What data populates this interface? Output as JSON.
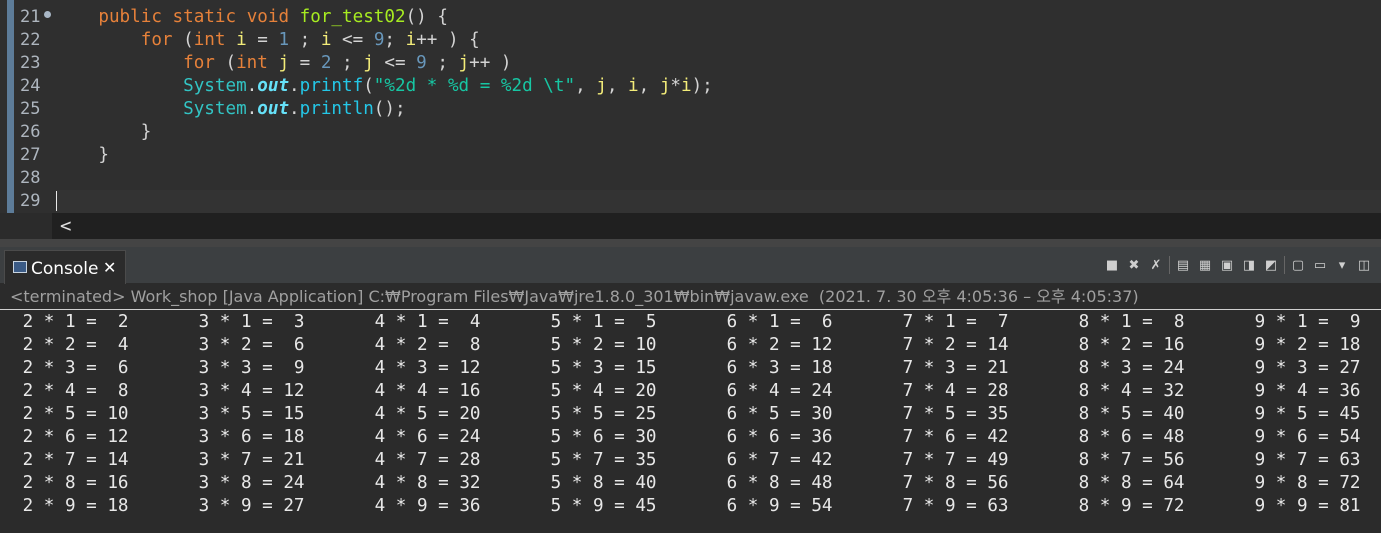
{
  "editor": {
    "line_numbers": [
      "21",
      "22",
      "23",
      "24",
      "25",
      "26",
      "27",
      "28",
      "29"
    ],
    "lines": [
      [
        {
          "t": "    "
        },
        {
          "t": "public",
          "c": "kw"
        },
        {
          "t": " "
        },
        {
          "t": "static",
          "c": "kw"
        },
        {
          "t": " "
        },
        {
          "t": "void",
          "c": "kw"
        },
        {
          "t": " "
        },
        {
          "t": "for_test02",
          "c": "fn"
        },
        {
          "t": "() {"
        }
      ],
      [
        {
          "t": "        "
        },
        {
          "t": "for",
          "c": "kw"
        },
        {
          "t": " ("
        },
        {
          "t": "int",
          "c": "kw"
        },
        {
          "t": " "
        },
        {
          "t": "i",
          "c": "var"
        },
        {
          "t": " = "
        },
        {
          "t": "1",
          "c": "num"
        },
        {
          "t": " ; "
        },
        {
          "t": "i",
          "c": "var"
        },
        {
          "t": " <= "
        },
        {
          "t": "9",
          "c": "num"
        },
        {
          "t": "; "
        },
        {
          "t": "i",
          "c": "var"
        },
        {
          "t": "++ ) {"
        }
      ],
      [
        {
          "t": "            "
        },
        {
          "t": "for",
          "c": "kw"
        },
        {
          "t": " ("
        },
        {
          "t": "int",
          "c": "kw"
        },
        {
          "t": " "
        },
        {
          "t": "j",
          "c": "var"
        },
        {
          "t": " = "
        },
        {
          "t": "2",
          "c": "num"
        },
        {
          "t": " ; "
        },
        {
          "t": "j",
          "c": "var"
        },
        {
          "t": " <= "
        },
        {
          "t": "9",
          "c": "num"
        },
        {
          "t": " ; "
        },
        {
          "t": "j",
          "c": "var"
        },
        {
          "t": "++ )"
        }
      ],
      [
        {
          "t": "            "
        },
        {
          "t": "System",
          "c": "cls"
        },
        {
          "t": "."
        },
        {
          "t": "out",
          "c": "fld"
        },
        {
          "t": "."
        },
        {
          "t": "printf",
          "c": "mth"
        },
        {
          "t": "("
        },
        {
          "t": "\"%2d * %d = %2d \\t\"",
          "c": "str"
        },
        {
          "t": ", "
        },
        {
          "t": "j",
          "c": "var"
        },
        {
          "t": ", "
        },
        {
          "t": "i",
          "c": "var"
        },
        {
          "t": ", "
        },
        {
          "t": "j",
          "c": "var"
        },
        {
          "t": "*"
        },
        {
          "t": "i",
          "c": "var"
        },
        {
          "t": ");"
        }
      ],
      [
        {
          "t": "            "
        },
        {
          "t": "System",
          "c": "cls"
        },
        {
          "t": "."
        },
        {
          "t": "out",
          "c": "fld"
        },
        {
          "t": "."
        },
        {
          "t": "println",
          "c": "mth"
        },
        {
          "t": "();"
        }
      ],
      [
        {
          "t": "        }"
        }
      ],
      [
        {
          "t": "    }"
        }
      ],
      [
        {
          "t": ""
        }
      ],
      [
        {
          "t": ""
        }
      ]
    ],
    "hscroll_left_icon": "chevron-left-icon"
  },
  "console": {
    "tab_label": "Console",
    "close_glyph": "✕",
    "status": "<terminated> Work_shop [Java Application] C:₩Program Files₩Java₩jre1.8.0_301₩bin₩javaw.exe  (2021. 7. 30 오후 4:05:36 – 오후 4:05:37)",
    "toolbar_icons": [
      "terminate-icon",
      "remove-launch-icon",
      "remove-all-terminated-icon",
      "scroll-lock-icon",
      "word-wrap-icon",
      "show-console-on-output-icon",
      "show-console-on-error-icon",
      "pin-console-icon",
      "display-selected-console-icon",
      "open-console-icon",
      "new-console-icon"
    ],
    "output_rows": [
      [
        " 2 * 1 =  2",
        " 3 * 1 =  3",
        " 4 * 1 =  4",
        " 5 * 1 =  5",
        " 6 * 1 =  6",
        " 7 * 1 =  7",
        " 8 * 1 =  8",
        " 9 * 1 =  9"
      ],
      [
        " 2 * 2 =  4",
        " 3 * 2 =  6",
        " 4 * 2 =  8",
        " 5 * 2 = 10",
        " 6 * 2 = 12",
        " 7 * 2 = 14",
        " 8 * 2 = 16",
        " 9 * 2 = 18"
      ],
      [
        " 2 * 3 =  6",
        " 3 * 3 =  9",
        " 4 * 3 = 12",
        " 5 * 3 = 15",
        " 6 * 3 = 18",
        " 7 * 3 = 21",
        " 8 * 3 = 24",
        " 9 * 3 = 27"
      ],
      [
        " 2 * 4 =  8",
        " 3 * 4 = 12",
        " 4 * 4 = 16",
        " 5 * 4 = 20",
        " 6 * 4 = 24",
        " 7 * 4 = 28",
        " 8 * 4 = 32",
        " 9 * 4 = 36"
      ],
      [
        " 2 * 5 = 10",
        " 3 * 5 = 15",
        " 4 * 5 = 20",
        " 5 * 5 = 25",
        " 6 * 5 = 30",
        " 7 * 5 = 35",
        " 8 * 5 = 40",
        " 9 * 5 = 45"
      ],
      [
        " 2 * 6 = 12",
        " 3 * 6 = 18",
        " 4 * 6 = 24",
        " 5 * 6 = 30",
        " 6 * 6 = 36",
        " 7 * 6 = 42",
        " 8 * 6 = 48",
        " 9 * 6 = 54"
      ],
      [
        " 2 * 7 = 14",
        " 3 * 7 = 21",
        " 4 * 7 = 28",
        " 5 * 7 = 35",
        " 6 * 7 = 42",
        " 7 * 7 = 49",
        " 8 * 7 = 56",
        " 9 * 7 = 63"
      ],
      [
        " 2 * 8 = 16",
        " 3 * 8 = 24",
        " 4 * 8 = 32",
        " 5 * 8 = 40",
        " 6 * 8 = 48",
        " 7 * 8 = 56",
        " 8 * 8 = 64",
        " 9 * 8 = 72"
      ],
      [
        " 2 * 9 = 18",
        " 3 * 9 = 27",
        " 4 * 9 = 36",
        " 5 * 9 = 45",
        " 6 * 9 = 54",
        " 7 * 9 = 63",
        " 8 * 9 = 72",
        " 9 * 9 = 81"
      ]
    ]
  }
}
